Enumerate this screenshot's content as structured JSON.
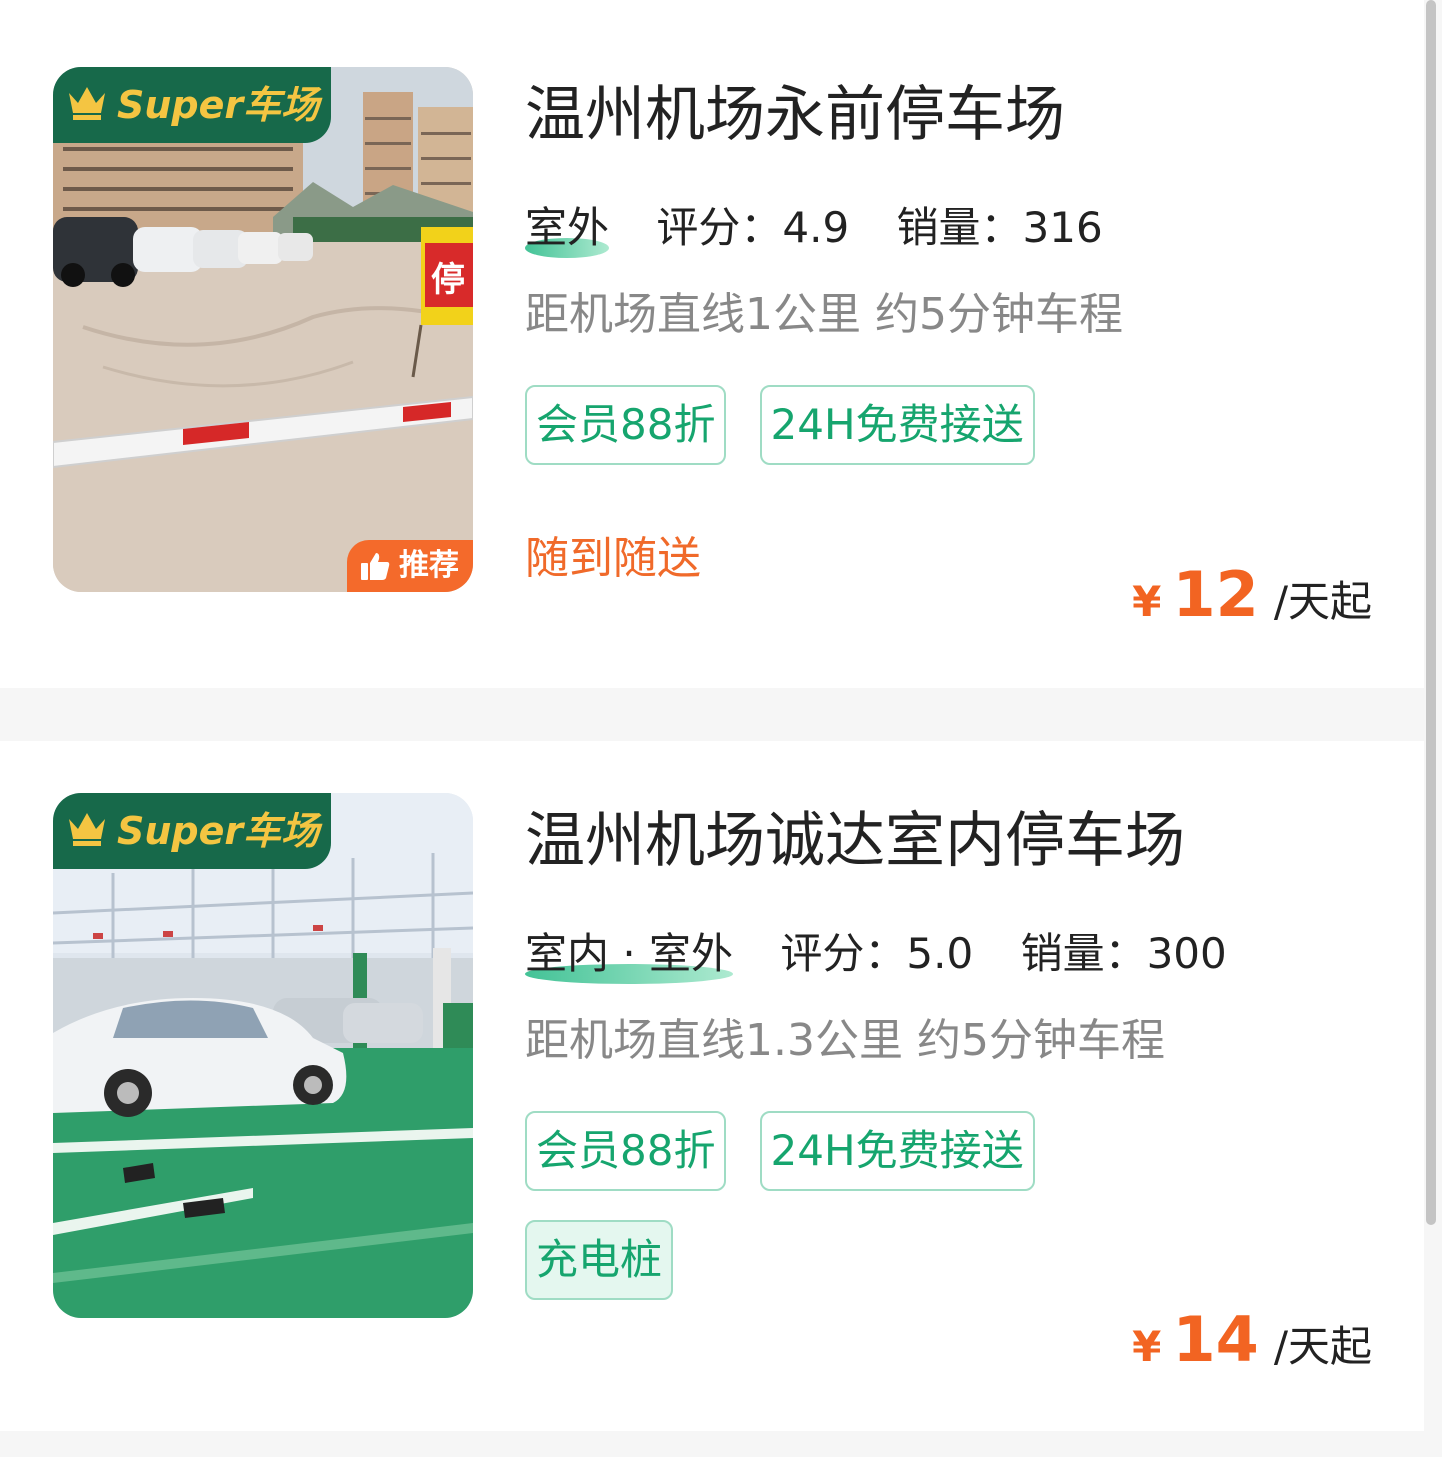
{
  "colors": {
    "accent_green": "#16a56e",
    "super_badge_green": "#17694a",
    "super_text_gold": "#f4c542",
    "price_orange": "#f26422",
    "promo_orange": "#f06a2a"
  },
  "lots": [
    {
      "super_badge": "Super车场",
      "recommend_badge": "推荐",
      "name": "温州机场永前停车场",
      "type": "室外",
      "rating": "评分：4.9",
      "sales": "销量：316",
      "distance": "距机场直线1公里 约5分钟车程",
      "tags": [
        "会员88折",
        "24H免费接送"
      ],
      "promo": "随到随送",
      "price_symbol": "¥",
      "price": "12",
      "price_unit": "/天起",
      "icons": [
        "crown-icon",
        "thumbs-up-icon"
      ]
    },
    {
      "super_badge": "Super车场",
      "name": "温州机场诚达室内停车场",
      "type": "室内 · 室外",
      "rating": "评分：5.0",
      "sales": "销量：300",
      "distance": "距机场直线1.3公里 约5分钟车程",
      "tags": [
        "会员88折",
        "24H免费接送"
      ],
      "extra_tag": "充电桩",
      "price_symbol": "¥",
      "price": "14",
      "price_unit": "/天起",
      "icons": [
        "crown-icon"
      ]
    }
  ]
}
